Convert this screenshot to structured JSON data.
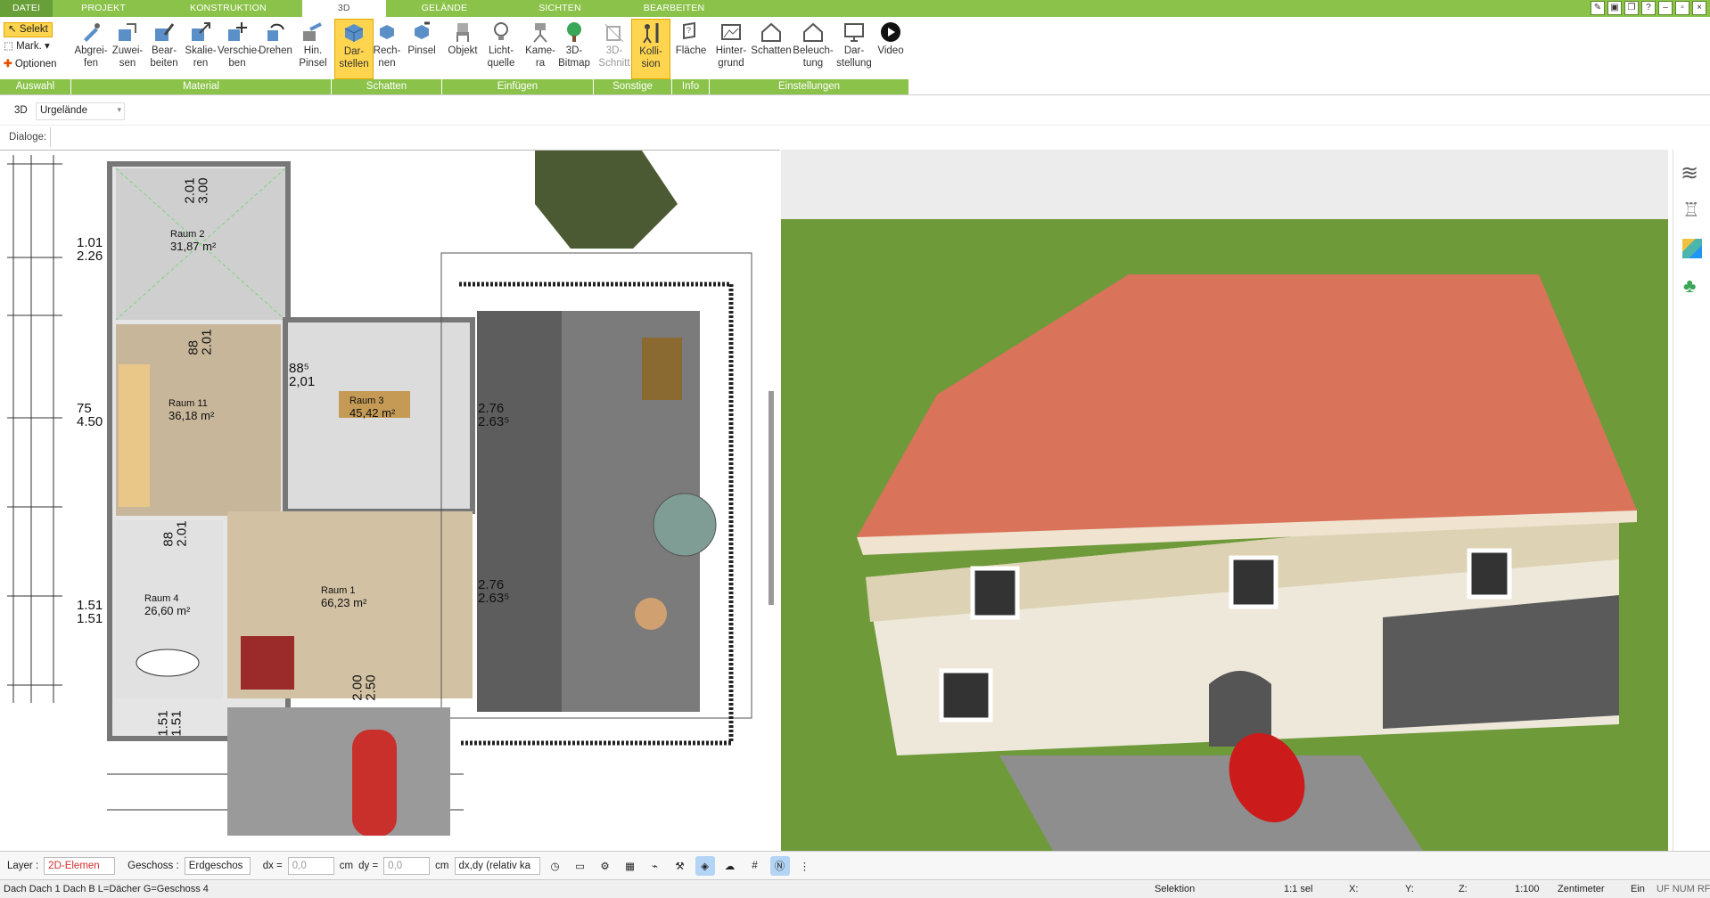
{
  "menu_tabs": [
    "DATEI",
    "PROJEKT",
    "KONSTRUKTION",
    "3D",
    "GELÄNDE",
    "SICHTEN",
    "BEARBEITEN"
  ],
  "selection": {
    "selekt": "Selekt",
    "mark": "Mark.",
    "optionen": "Optionen"
  },
  "ribbon": {
    "abgreifen": "Abgrei-\nfen",
    "zuweisen": "Zuwei-\nsen",
    "bearbeiten": "Bear-\nbeiten",
    "skalieren": "Skalie-\nren",
    "verschieben": "Verschie-\nben",
    "drehen": "Drehen",
    "hinpinsel": "Hin.\nPinsel",
    "darstellen": "Dar-\nstellen",
    "rechnen": "Rech-\nnen",
    "pinsel": "Pinsel",
    "objekt": "Objekt",
    "lichtquelle": "Licht-\nquelle",
    "kamera": "Kame-\nra",
    "bitmap3d": "3D-\nBitmap",
    "schnitt3d": "3D-\nSchnitt",
    "kollision": "Kolli-\nsion",
    "flaeche": "Fläche",
    "hintergrund": "Hinter-\ngrund",
    "schatten": "Schatten",
    "beleuchtung": "Beleuch-\ntung",
    "darstellung": "Dar-\nstellung",
    "video": "Video"
  },
  "groups": {
    "auswahl": "Auswahl",
    "material": "Material",
    "schatten": "Schatten",
    "einfuegen": "Einfügen",
    "sonstige": "Sonstige",
    "info": "Info",
    "einstellungen": "Einstellungen"
  },
  "view_bar": {
    "mode": "3D",
    "terrain": "Urgelände"
  },
  "dialog_label": "Dialoge:",
  "rooms": [
    {
      "name": "Raum 2",
      "area": "31,87 m²"
    },
    {
      "name": "Raum 11",
      "area": "36,18 m²"
    },
    {
      "name": "Raum 3",
      "area": "45,42 m²"
    },
    {
      "name": "Raum 4",
      "area": "26,60 m²"
    },
    {
      "name": "Raum 1",
      "area": "66,23 m²"
    }
  ],
  "dims": {
    "d1": "1.01\n2.26",
    "d2": "75\n4.50",
    "d3": "1.51\n1.51",
    "d4": "2.01\n3.00",
    "d5": "88\n2.01",
    "d6": "88⁵\n2,01",
    "d7": "2.76\n2.63⁵",
    "d8": "2.76\n2.63⁵",
    "d9": "88\n2.01",
    "d10": "2.00\n2.50",
    "d11": "1.51\n1.51"
  },
  "status": {
    "layer_label": "Layer :",
    "layer_value": "2D-Elemen",
    "geschoss_label": "Geschoss :",
    "geschoss_value": "Erdgeschos",
    "dx_label": "dx =",
    "dx_value": "0,0",
    "dy_label": "dy =",
    "dy_value": "0,0",
    "unit": "cm",
    "mode": "dx,dy (relativ ka"
  },
  "info": {
    "left": "Dach Dach 1 Dach B L=Dächer G=Geschoss 4",
    "selektion": "Selektion",
    "sel": "1:1 sel",
    "x": "X:",
    "y": "Y:",
    "z": "Z:",
    "scale": "1:100",
    "unit": "Zentimeter",
    "ein": "Ein",
    "flags": "UF NUM RF"
  },
  "colors": {
    "accent": "#8bc34a",
    "highlight": "#ffd54f",
    "roof": "#d9735a",
    "grass": "#6f9a3a"
  }
}
